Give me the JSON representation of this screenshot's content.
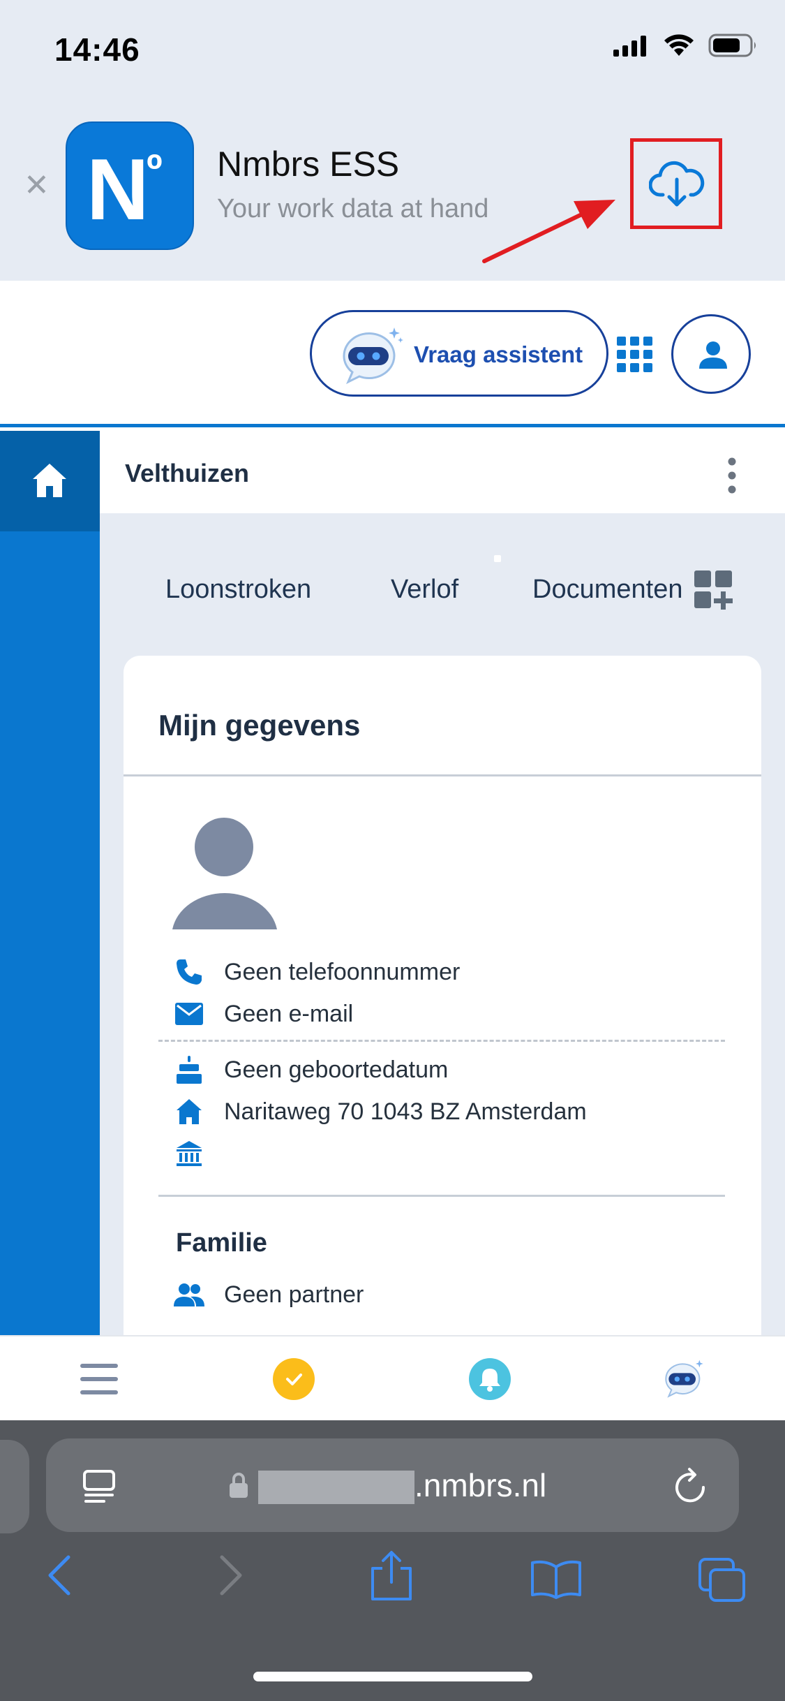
{
  "status_bar": {
    "time": "14:46",
    "icons": [
      "signal-icon",
      "wifi-icon",
      "battery-icon"
    ]
  },
  "app_banner": {
    "icon_letter": "N",
    "icon_superscript": "º",
    "app_name": "Nmbrs ESS",
    "subtitle": "Your work data at hand",
    "action_icon": "cloud-download-icon",
    "highlight_color": "#e11d21"
  },
  "header": {
    "assistant_label": "Vraag assistent",
    "icons": [
      "robot-chat-icon",
      "apps-grid-icon",
      "user-icon"
    ]
  },
  "sidebar": {
    "items": [
      {
        "icon": "home-icon",
        "active": true
      }
    ]
  },
  "company_bar": {
    "name": "Velthuizen"
  },
  "tabs": [
    {
      "label": "Loonstroken"
    },
    {
      "label": "Verlof"
    },
    {
      "label": "Documenten"
    }
  ],
  "card": {
    "title": "Mijn gegevens",
    "contact": [
      {
        "icon": "phone-icon",
        "text": "Geen telefoonnummer"
      },
      {
        "icon": "mail-icon",
        "text": "Geen e-mail"
      }
    ],
    "personal": [
      {
        "icon": "cake-icon",
        "text": "Geen geboortedatum"
      },
      {
        "icon": "home-icon",
        "text": "Naritaweg 70 1043 BZ Amsterdam"
      },
      {
        "icon": "bank-icon",
        "text": ""
      }
    ],
    "family_title": "Familie",
    "family": [
      {
        "icon": "people-icon",
        "text": "Geen partner"
      }
    ]
  },
  "bottom_nav": {
    "items": [
      "menu-icon",
      "check-icon",
      "bell-icon",
      "robot-chat-icon"
    ]
  },
  "browser": {
    "url_suffix": ".nmbrs.nl"
  },
  "colors": {
    "brand_blue": "#0a77cf",
    "dark_navy": "#1f2f44",
    "assistant_blue": "#1d4fb0",
    "check_yellow": "#fbbd1a",
    "bell_cyan": "#4cc3e0"
  }
}
